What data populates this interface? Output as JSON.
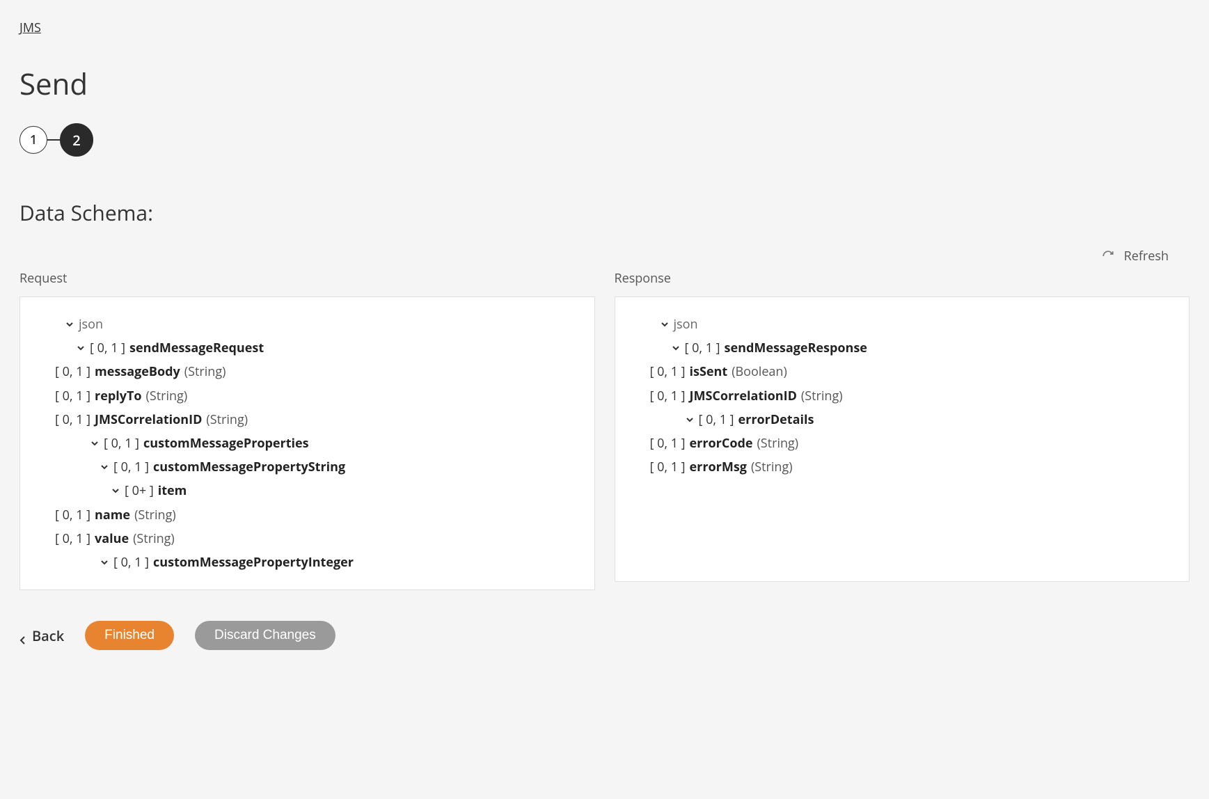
{
  "breadcrumb": "JMS",
  "title": "Send",
  "stepper": {
    "step1": "1",
    "step2": "2"
  },
  "sectionTitle": "Data Schema:",
  "refresh": "Refresh",
  "request": {
    "label": "Request",
    "root": "json",
    "rows": [
      {
        "indent": 1,
        "chevron": true,
        "card": "[ 0, 1 ]",
        "name": "sendMessageRequest",
        "type": ""
      },
      {
        "indent": 2,
        "chevron": false,
        "card": "[ 0, 1 ]",
        "name": "messageBody",
        "type": "(String)"
      },
      {
        "indent": 2,
        "chevron": false,
        "card": "[ 0, 1 ]",
        "name": "replyTo",
        "type": "(String)"
      },
      {
        "indent": 2,
        "chevron": false,
        "card": "[ 0, 1 ]",
        "name": "JMSCorrelationID",
        "type": "(String)"
      },
      {
        "indent": 2,
        "chevron": true,
        "card": "[ 0, 1 ]",
        "name": "customMessageProperties",
        "type": ""
      },
      {
        "indent": 3,
        "chevron": true,
        "card": "[ 0, 1 ]",
        "name": "customMessagePropertyString",
        "type": ""
      },
      {
        "indent": 4,
        "chevron": true,
        "card": "[ 0+ ]",
        "name": "item",
        "type": ""
      },
      {
        "indent": 5,
        "chevron": false,
        "card": "[ 0, 1 ]",
        "name": "name",
        "type": "(String)"
      },
      {
        "indent": 5,
        "chevron": false,
        "card": "[ 0, 1 ]",
        "name": "value",
        "type": "(String)"
      },
      {
        "indent": 3,
        "chevron": true,
        "card": "[ 0, 1 ]",
        "name": "customMessagePropertyInteger",
        "type": ""
      }
    ]
  },
  "response": {
    "label": "Response",
    "root": "json",
    "rows": [
      {
        "indent": 1,
        "chevron": true,
        "card": "[ 0, 1 ]",
        "name": "sendMessageResponse",
        "type": ""
      },
      {
        "indent": 2,
        "chevron": false,
        "card": "[ 0, 1 ]",
        "name": "isSent",
        "type": "(Boolean)"
      },
      {
        "indent": 2,
        "chevron": false,
        "card": "[ 0, 1 ]",
        "name": "JMSCorrelationID",
        "type": "(String)"
      },
      {
        "indent": 2,
        "chevron": true,
        "card": "[ 0, 1 ]",
        "name": "errorDetails",
        "type": ""
      },
      {
        "indent": 3,
        "chevron": false,
        "card": "[ 0, 1 ]",
        "name": "errorCode",
        "type": "(String)"
      },
      {
        "indent": 3,
        "chevron": false,
        "card": "[ 0, 1 ]",
        "name": "errorMsg",
        "type": "(String)"
      }
    ]
  },
  "footer": {
    "back": "Back",
    "finished": "Finished",
    "discard": "Discard Changes"
  }
}
